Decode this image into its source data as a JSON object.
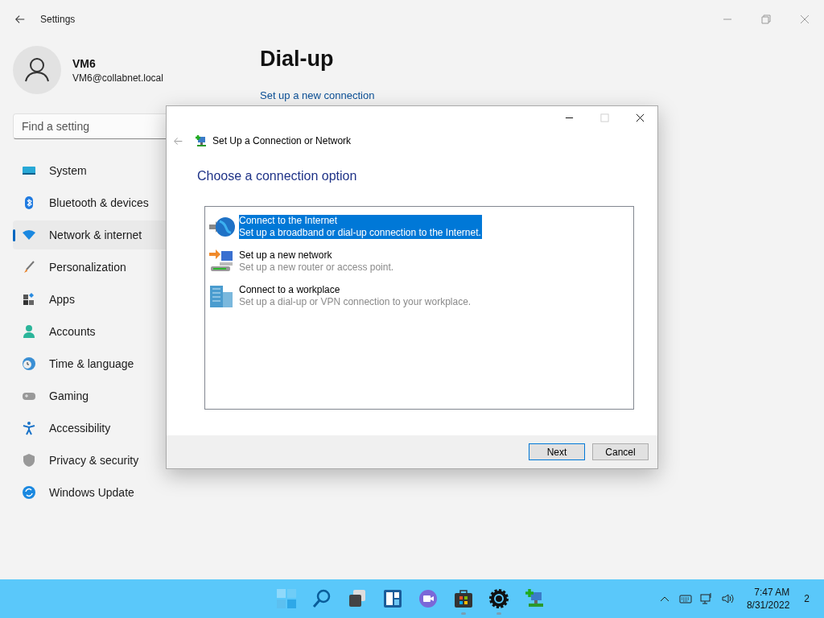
{
  "settings_window": {
    "title": "Settings",
    "user": {
      "name": "VM6",
      "email": "VM6@collabnet.local"
    },
    "search": {
      "placeholder": "Find a setting"
    },
    "nav_items": [
      {
        "label": "System",
        "kind": "system",
        "selected": false
      },
      {
        "label": "Bluetooth & devices",
        "kind": "bluetooth",
        "selected": false
      },
      {
        "label": "Network & internet",
        "kind": "network",
        "selected": true
      },
      {
        "label": "Personalization",
        "kind": "brush",
        "selected": false
      },
      {
        "label": "Apps",
        "kind": "apps",
        "selected": false
      },
      {
        "label": "Accounts",
        "kind": "accounts",
        "selected": false
      },
      {
        "label": "Time & language",
        "kind": "time",
        "selected": false
      },
      {
        "label": "Gaming",
        "kind": "gaming",
        "selected": false
      },
      {
        "label": "Accessibility",
        "kind": "accessibility",
        "selected": false
      },
      {
        "label": "Privacy & security",
        "kind": "privacy",
        "selected": false
      },
      {
        "label": "Windows Update",
        "kind": "update",
        "selected": false
      }
    ],
    "page_title": "Dial-up",
    "link": "Set up a new connection"
  },
  "dialog": {
    "title": "Set Up a Connection or Network",
    "heading": "Choose a connection option",
    "options": [
      {
        "kind": "internet",
        "title": "Connect to the Internet",
        "description": "Set up a broadband or dial-up connection to the Internet.",
        "selected": true
      },
      {
        "kind": "network",
        "title": "Set up a new network",
        "description": "Set up a new router or access point.",
        "selected": false
      },
      {
        "kind": "workplace",
        "title": "Connect to a workplace",
        "description": "Set up a dial-up or VPN connection to your workplace.",
        "selected": false
      }
    ],
    "buttons": [
      {
        "label": "Next",
        "default": true
      },
      {
        "label": "Cancel",
        "default": false
      }
    ]
  },
  "taskbar": {
    "apps": [
      {
        "kind": "start",
        "running": false
      },
      {
        "kind": "search",
        "running": false
      },
      {
        "kind": "taskview",
        "running": false
      },
      {
        "kind": "widgets",
        "running": false
      },
      {
        "kind": "chat",
        "running": false
      },
      {
        "kind": "store",
        "running": true
      },
      {
        "kind": "settings",
        "running": true
      },
      {
        "kind": "netsetup",
        "running": false
      }
    ],
    "time": "7:47 AM",
    "date": "8/31/2022",
    "notification_count": "2"
  }
}
